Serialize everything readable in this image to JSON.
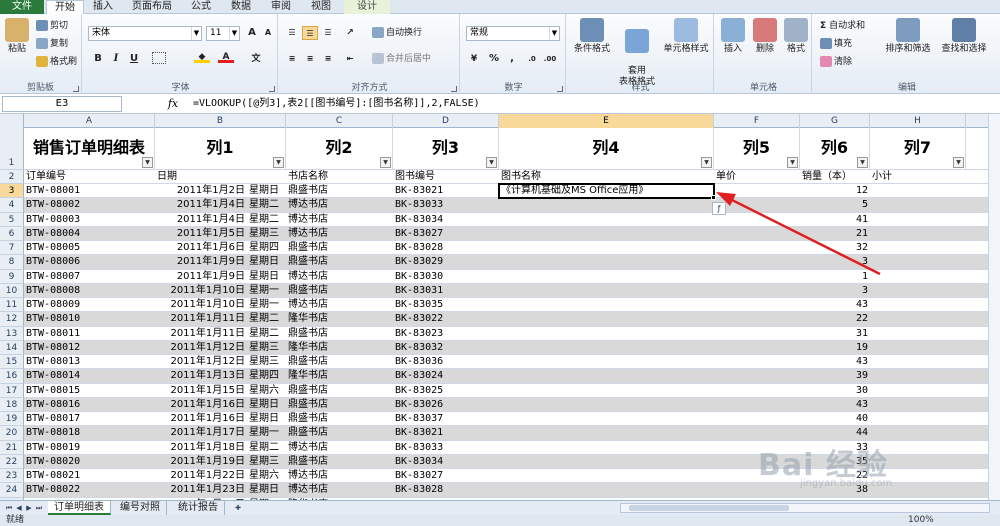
{
  "ribbon_tabs": [
    "文件",
    "开始",
    "插入",
    "页面布局",
    "公式",
    "数据",
    "审阅",
    "视图",
    "设计"
  ],
  "clipboard": {
    "paste": "粘贴",
    "cut": "剪切",
    "copy": "复制",
    "format_painter": "格式刷",
    "label": "剪贴板"
  },
  "font": {
    "name": "宋体",
    "size": "11",
    "label": "字体",
    "bold": "B",
    "italic": "I",
    "underline": "U"
  },
  "alignment": {
    "wrap": "自动换行",
    "merge": "合并后居中",
    "label": "对齐方式"
  },
  "number": {
    "format": "常规",
    "label": "数字",
    "percent": "%",
    "comma": ","
  },
  "styles": {
    "conditional": "条件格式",
    "table": "套用\n表格格式",
    "cell": "单元格样式",
    "label": "样式"
  },
  "cells": {
    "insert": "插入",
    "delete": "删除",
    "format": "格式",
    "label": "单元格"
  },
  "editing": {
    "autosum": "自动求和",
    "fill": "填充",
    "clear": "清除",
    "sort": "排序和筛选",
    "find": "查找和选择",
    "label": "编辑"
  },
  "formula_bar": {
    "name_box": "E3",
    "fx": "fx",
    "formula": "=VLOOKUP([@列3],表2[[图书编号]:[图书名称]],2,FALSE)"
  },
  "columns": [
    "A",
    "B",
    "C",
    "D",
    "E",
    "F",
    "G",
    "H"
  ],
  "header_row": [
    "销售订单明细表",
    "列1",
    "列2",
    "列3",
    "列4",
    "列5",
    "列6",
    "列7"
  ],
  "field_row": [
    "订单编号",
    "日期",
    "书店名称",
    "图书编号",
    "图书名称",
    "单价",
    "销量（本）",
    "小计"
  ],
  "rows": [
    {
      "n": "3",
      "id": "BTW-08001",
      "date": "2011年1月2日",
      "wd": "星期日",
      "store": "鼎盛书店",
      "book": "BK-83021",
      "name": "《计算机基础及MS Office应用》",
      "qty": "12"
    },
    {
      "n": "4",
      "id": "BTW-08002",
      "date": "2011年1月4日",
      "wd": "星期二",
      "store": "博达书店",
      "book": "BK-83033",
      "name": "",
      "qty": "5"
    },
    {
      "n": "5",
      "id": "BTW-08003",
      "date": "2011年1月4日",
      "wd": "星期二",
      "store": "博达书店",
      "book": "BK-83034",
      "name": "",
      "qty": "41"
    },
    {
      "n": "6",
      "id": "BTW-08004",
      "date": "2011年1月5日",
      "wd": "星期三",
      "store": "博达书店",
      "book": "BK-83027",
      "name": "",
      "qty": "21"
    },
    {
      "n": "7",
      "id": "BTW-08005",
      "date": "2011年1月6日",
      "wd": "星期四",
      "store": "鼎盛书店",
      "book": "BK-83028",
      "name": "",
      "qty": "32"
    },
    {
      "n": "8",
      "id": "BTW-08006",
      "date": "2011年1月9日",
      "wd": "星期日",
      "store": "鼎盛书店",
      "book": "BK-83029",
      "name": "",
      "qty": "3"
    },
    {
      "n": "9",
      "id": "BTW-08007",
      "date": "2011年1月9日",
      "wd": "星期日",
      "store": "博达书店",
      "book": "BK-83030",
      "name": "",
      "qty": "1"
    },
    {
      "n": "10",
      "id": "BTW-08008",
      "date": "2011年1月10日",
      "wd": "星期一",
      "store": "鼎盛书店",
      "book": "BK-83031",
      "name": "",
      "qty": "3"
    },
    {
      "n": "11",
      "id": "BTW-08009",
      "date": "2011年1月10日",
      "wd": "星期一",
      "store": "博达书店",
      "book": "BK-83035",
      "name": "",
      "qty": "43"
    },
    {
      "n": "12",
      "id": "BTW-08010",
      "date": "2011年1月11日",
      "wd": "星期二",
      "store": "隆华书店",
      "book": "BK-83022",
      "name": "",
      "qty": "22"
    },
    {
      "n": "13",
      "id": "BTW-08011",
      "date": "2011年1月11日",
      "wd": "星期二",
      "store": "鼎盛书店",
      "book": "BK-83023",
      "name": "",
      "qty": "31"
    },
    {
      "n": "14",
      "id": "BTW-08012",
      "date": "2011年1月12日",
      "wd": "星期三",
      "store": "隆华书店",
      "book": "BK-83032",
      "name": "",
      "qty": "19"
    },
    {
      "n": "15",
      "id": "BTW-08013",
      "date": "2011年1月12日",
      "wd": "星期三",
      "store": "鼎盛书店",
      "book": "BK-83036",
      "name": "",
      "qty": "43"
    },
    {
      "n": "16",
      "id": "BTW-08014",
      "date": "2011年1月13日",
      "wd": "星期四",
      "store": "隆华书店",
      "book": "BK-83024",
      "name": "",
      "qty": "39"
    },
    {
      "n": "17",
      "id": "BTW-08015",
      "date": "2011年1月15日",
      "wd": "星期六",
      "store": "鼎盛书店",
      "book": "BK-83025",
      "name": "",
      "qty": "30"
    },
    {
      "n": "18",
      "id": "BTW-08016",
      "date": "2011年1月16日",
      "wd": "星期日",
      "store": "鼎盛书店",
      "book": "BK-83026",
      "name": "",
      "qty": "43"
    },
    {
      "n": "19",
      "id": "BTW-08017",
      "date": "2011年1月16日",
      "wd": "星期日",
      "store": "鼎盛书店",
      "book": "BK-83037",
      "name": "",
      "qty": "40"
    },
    {
      "n": "20",
      "id": "BTW-08018",
      "date": "2011年1月17日",
      "wd": "星期一",
      "store": "鼎盛书店",
      "book": "BK-83021",
      "name": "",
      "qty": "44"
    },
    {
      "n": "21",
      "id": "BTW-08019",
      "date": "2011年1月18日",
      "wd": "星期二",
      "store": "博达书店",
      "book": "BK-83033",
      "name": "",
      "qty": "33"
    },
    {
      "n": "22",
      "id": "BTW-08020",
      "date": "2011年1月19日",
      "wd": "星期三",
      "store": "鼎盛书店",
      "book": "BK-83034",
      "name": "",
      "qty": "35"
    },
    {
      "n": "23",
      "id": "BTW-08021",
      "date": "2011年1月22日",
      "wd": "星期六",
      "store": "博达书店",
      "book": "BK-83027",
      "name": "",
      "qty": "22"
    },
    {
      "n": "24",
      "id": "BTW-08022",
      "date": "2011年1月23日",
      "wd": "星期日",
      "store": "博达书店",
      "book": "BK-83028",
      "name": "",
      "qty": "38"
    },
    {
      "n": "25",
      "id": "BTW-08023",
      "date": "2011年1月24日",
      "wd": "星期一",
      "store": "隆华书店",
      "book": "BK-83029",
      "name": "",
      "qty": "5"
    }
  ],
  "sheets": [
    "订单明细表",
    "编号对照",
    "统计报告"
  ],
  "status": {
    "left": "就绪",
    "zoom": "100%"
  },
  "watermark": {
    "text": "Bai 经验",
    "sub": "jingyan.baidu.com"
  },
  "colors": {
    "file_tab": "#2a7a3b",
    "band": "#d9d9d9",
    "arrow": "#e02020",
    "selected_header": "#f9d99a"
  }
}
